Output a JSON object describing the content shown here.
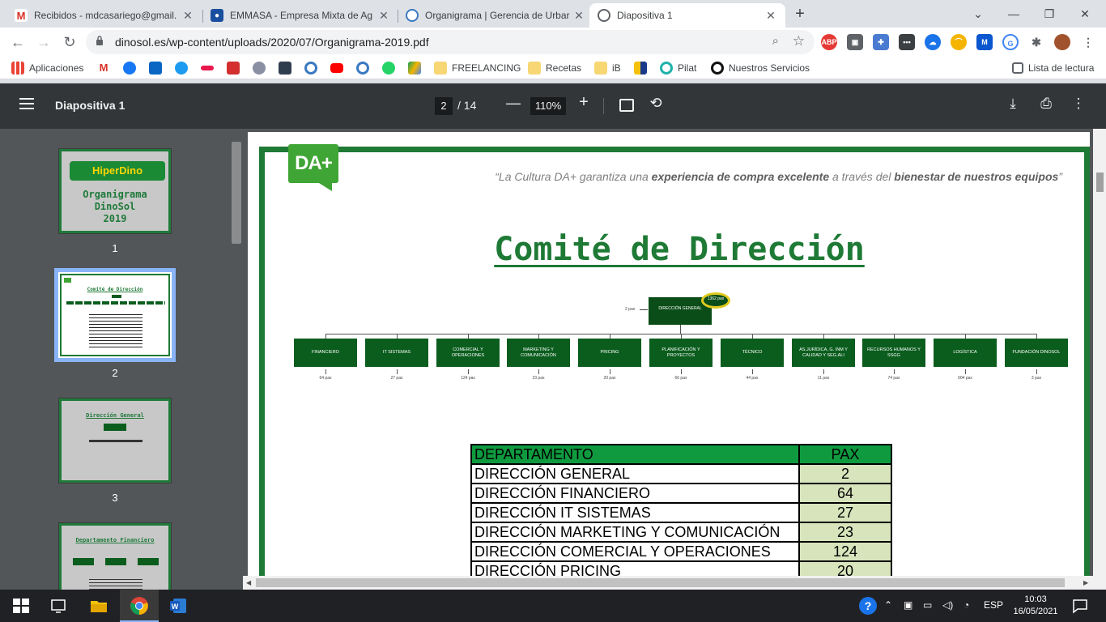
{
  "browser": {
    "tabs": [
      {
        "title": "Recibidos - mdcasariego@gmail.",
        "icon": "gmail-icon",
        "color": "#d93025"
      },
      {
        "title": "EMMASA - Empresa Mixta de Ag",
        "icon": "water-drop-icon",
        "color": "#1a4fa0"
      },
      {
        "title": "Organigrama | Gerencia de Urbar",
        "icon": "globe-icon",
        "color": "#3a79c2"
      },
      {
        "title": "Diapositiva 1",
        "icon": "globe-icon",
        "color": "#5f6368"
      }
    ],
    "url": "dinosol.es/wp-content/uploads/2020/07/Organigrama-2019.pdf",
    "bookmarks": {
      "apps": "Aplicaciones",
      "freelancing": "FREELANCING",
      "recetas": "Recetas",
      "ib": "iB",
      "pilat": "Pilat",
      "servicios": "Nuestros Servicios",
      "reading_list": "Lista de lectura"
    }
  },
  "pdf": {
    "title": "Diapositiva 1",
    "current_page": "2",
    "total_pages": "/ 14",
    "zoom": "110%",
    "thumb_numbers": [
      "1",
      "2",
      "3"
    ],
    "thumb1_text": "Organigrama\nDinoSol\n2019",
    "thumb1_logo": "HiperDino",
    "thumb3_title": "Dirección General",
    "thumb4_title": "Departamento Financiero"
  },
  "slide": {
    "logo": "DA+",
    "motto_1": "“La Cultura DA+ garantiza una ",
    "motto_2": "experiencia de compra excelente",
    "motto_3": " a través del ",
    "motto_4": "bienestar de nuestros equipos",
    "motto_5": "”",
    "title": "Comité de Dirección",
    "top_node": {
      "label": "DIRECCIÓN GENERAL",
      "pax": "2 pax",
      "bubble": "1362 pax"
    },
    "departments": [
      {
        "label": "FINANCIERO",
        "pax": "64 pax"
      },
      {
        "label": "IT SISTEMAS",
        "pax": "27 pax"
      },
      {
        "label": "COMERCIAL Y OPERACIONES",
        "pax": "124 pax"
      },
      {
        "label": "MARKETING Y COMUNICACIÓN",
        "pax": "23 pax"
      },
      {
        "label": "PRICING",
        "pax": "20 pax"
      },
      {
        "label": "PLANIFICACIÓN Y PROYECTOS",
        "pax": "66 pax"
      },
      {
        "label": "TÉCNICO",
        "pax": "44 pax"
      },
      {
        "label": "AS.JURÍDICA, G. INM Y CALIDAD Y SEG.ALI",
        "pax": "11 pax"
      },
      {
        "label": "RECURSOS HUMANOS Y SSGG",
        "pax": "74 pax"
      },
      {
        "label": "LOGÍSTICA",
        "pax": "604 pax"
      },
      {
        "label": "FUNDACIÓN DINOSOL",
        "pax": "3 pax"
      }
    ],
    "table": {
      "header": {
        "dept": "DEPARTAMENTO",
        "pax": "PAX"
      },
      "rows": [
        {
          "dept": "DIRECCIÓN GENERAL",
          "pax": "2"
        },
        {
          "dept": "DIRECCIÓN FINANCIERO",
          "pax": "64"
        },
        {
          "dept": "DIRECCIÓN IT SISTEMAS",
          "pax": "27"
        },
        {
          "dept": "DIRECCIÓN MARKETING Y COMUNICACIÓN",
          "pax": "23"
        },
        {
          "dept": "DIRECCIÓN COMERCIAL Y OPERACIONES",
          "pax": "124"
        },
        {
          "dept": "DIRECCIÓN PRICING",
          "pax": "20"
        }
      ]
    }
  },
  "taskbar": {
    "lang": "ESP",
    "time": "10:03",
    "date": "16/05/2021"
  },
  "colors": {
    "brand_green": "#1e7a35",
    "table_header": "#0f9a3f",
    "value_cell": "#d8e4bc"
  }
}
